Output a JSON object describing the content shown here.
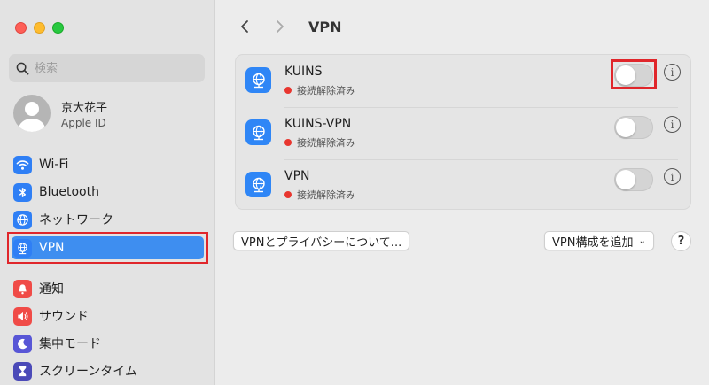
{
  "sidebar": {
    "search_placeholder": "検索",
    "account": {
      "name": "京大花子",
      "subtitle": "Apple ID"
    },
    "items": [
      {
        "label": "Wi-Fi",
        "icon": "wifi-icon"
      },
      {
        "label": "Bluetooth",
        "icon": "bluetooth-icon"
      },
      {
        "label": "ネットワーク",
        "icon": "globe-icon"
      },
      {
        "label": "VPN",
        "icon": "vpn-globe-icon",
        "selected": true
      },
      {
        "label": "通知",
        "icon": "bell-icon"
      },
      {
        "label": "サウンド",
        "icon": "speaker-icon"
      },
      {
        "label": "集中モード",
        "icon": "moon-icon"
      },
      {
        "label": "スクリーンタイム",
        "icon": "hourglass-icon"
      }
    ]
  },
  "main": {
    "title": "VPN",
    "vpns": [
      {
        "name": "KUINS",
        "status": "接続解除済み",
        "enabled": false
      },
      {
        "name": "KUINS-VPN",
        "status": "接続解除済み",
        "enabled": false
      },
      {
        "name": "VPN",
        "status": "接続解除済み",
        "enabled": false
      }
    ],
    "privacy_button": "VPNとプライバシーについて...",
    "add_button": "VPN構成を追加",
    "help_label": "?",
    "info_label": "i"
  },
  "colors": {
    "accent": "#3e8ef0",
    "highlight": "#e0262b",
    "status_disconnected": "#e8362f"
  }
}
